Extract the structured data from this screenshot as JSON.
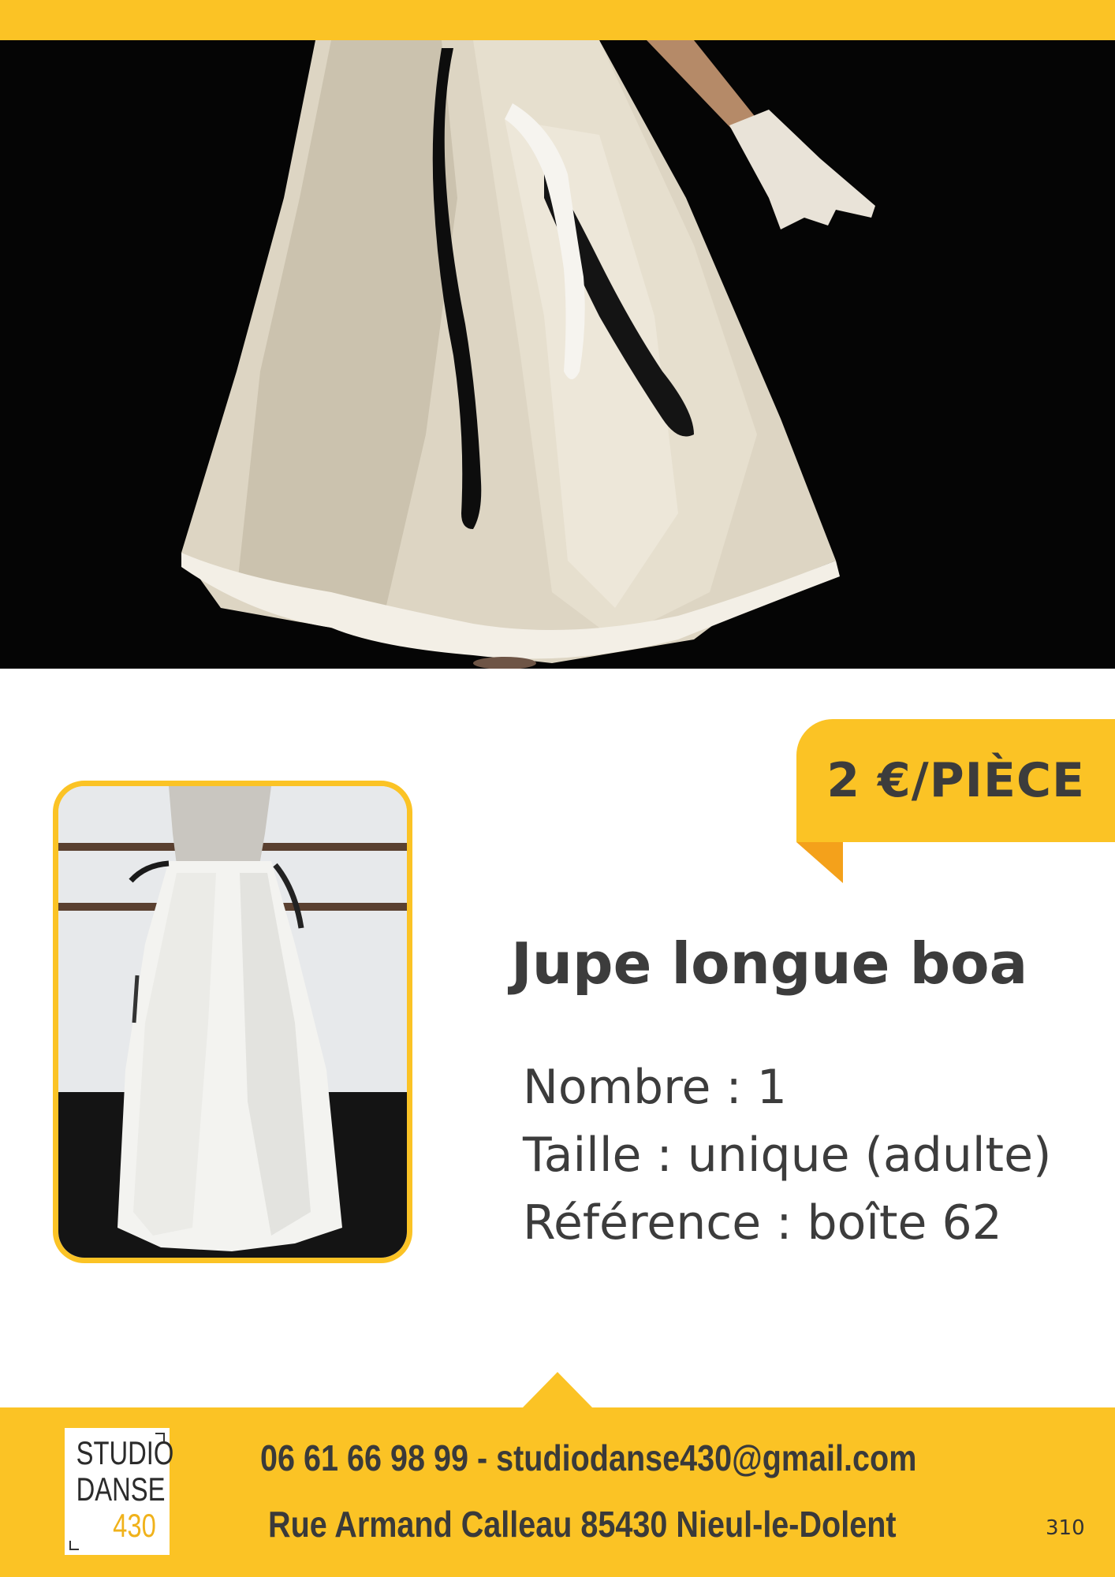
{
  "price": {
    "label": "2 €/PIÈCE"
  },
  "product": {
    "title": "Jupe longue boa",
    "details": [
      "Nombre : 1",
      "Taille : unique (adulte)",
      "Référence : boîte 62"
    ]
  },
  "footer": {
    "logo_lines": [
      "STUDIO",
      "DANSE",
      "430"
    ],
    "contact_line": "06 61 66 98 99 - studiodanse430@gmail.com",
    "address_line": "Rue Armand Calleau 85430 Nieul-le-Dolent",
    "page_number": "310"
  },
  "colors": {
    "accent": "#fbc325",
    "accent_dark": "#f4a11b",
    "text": "#3c3c3c",
    "hero_bg": "#050505"
  }
}
